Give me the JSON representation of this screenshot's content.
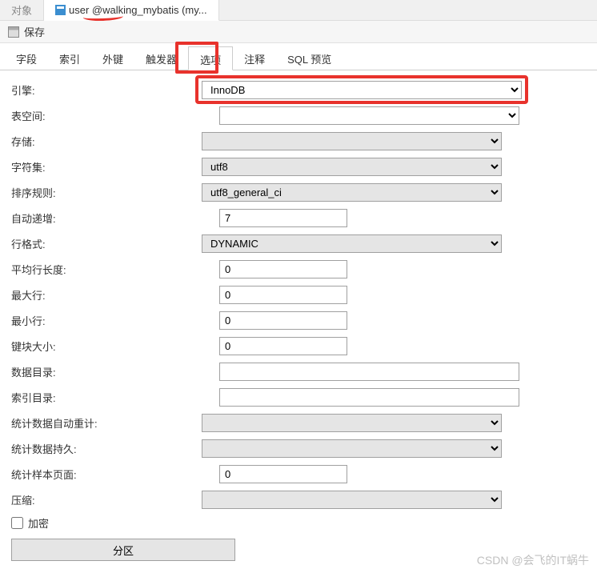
{
  "topTabs": {
    "obj": "对象",
    "activeTitle": "user @walking_mybatis (my..."
  },
  "toolbar": {
    "save": "保存"
  },
  "innerTabs": {
    "fields": "字段",
    "indexes": "索引",
    "foreignKeys": "外键",
    "triggers": "触发器",
    "options": "选项",
    "comments": "注释",
    "sqlPreview": "SQL 预览"
  },
  "form": {
    "engine": {
      "label": "引擎:",
      "value": "InnoDB"
    },
    "tablespace": {
      "label": "表空间:",
      "value": ""
    },
    "storage": {
      "label": "存储:",
      "value": ""
    },
    "charset": {
      "label": "字符集:",
      "value": "utf8"
    },
    "collation": {
      "label": "排序规则:",
      "value": "utf8_general_ci"
    },
    "autoIncrement": {
      "label": "自动递增:",
      "value": "7"
    },
    "rowFormat": {
      "label": "行格式:",
      "value": "DYNAMIC"
    },
    "avgRowLength": {
      "label": "平均行长度:",
      "value": "0"
    },
    "maxRows": {
      "label": "最大行:",
      "value": "0"
    },
    "minRows": {
      "label": "最小行:",
      "value": "0"
    },
    "keyBlockSize": {
      "label": "键块大小:",
      "value": "0"
    },
    "dataDir": {
      "label": "数据目录:",
      "value": ""
    },
    "indexDir": {
      "label": "索引目录:",
      "value": ""
    },
    "statsAutoRecalc": {
      "label": "统计数据自动重计:",
      "value": ""
    },
    "statsPersistent": {
      "label": "统计数据持久:",
      "value": ""
    },
    "statsSamplePages": {
      "label": "统计样本页面:",
      "value": "0"
    },
    "compression": {
      "label": "压缩:",
      "value": ""
    },
    "encryption": {
      "label": "加密"
    },
    "partition": "分区"
  },
  "watermark": "CSDN @会飞的IT蜗牛"
}
